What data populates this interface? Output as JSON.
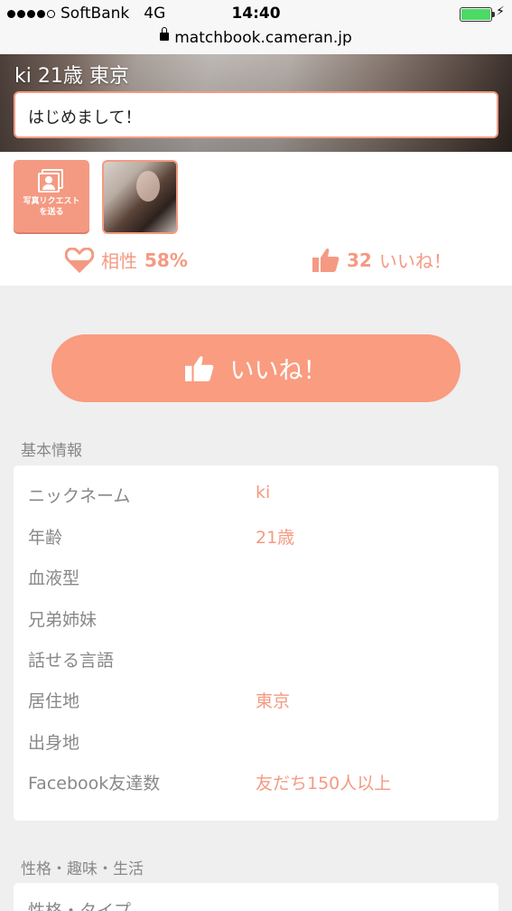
{
  "status": {
    "carrier": "SoftBank",
    "network": "4G",
    "time": "14:40"
  },
  "browser": {
    "url": "matchbook.cameran.jp"
  },
  "profile": {
    "title": "ki 21歳 東京",
    "greeting": "はじめまして！",
    "photo_request_label": "写真リクエストを送る",
    "compat_label": "相性",
    "compat_value": "58%",
    "likes_count": "32",
    "likes_label": "いいね！"
  },
  "like_button": {
    "label": "いいね！"
  },
  "basic_info": {
    "heading": "基本情報",
    "rows": [
      {
        "label": "ニックネーム",
        "value": "ki"
      },
      {
        "label": "年齢",
        "value": "21歳"
      },
      {
        "label": "血液型",
        "value": ""
      },
      {
        "label": "兄弟姉妹",
        "value": ""
      },
      {
        "label": "話せる言語",
        "value": ""
      },
      {
        "label": "居住地",
        "value": "東京"
      },
      {
        "label": "出身地",
        "value": ""
      },
      {
        "label": "Facebook友達数",
        "value": "友だち150人以上"
      }
    ]
  },
  "personality": {
    "heading": "性格・趣味・生活",
    "rows": [
      {
        "label": "性格・タイプ"
      }
    ]
  },
  "colors": {
    "accent": "#f49a82",
    "label_gray": "#888888"
  }
}
